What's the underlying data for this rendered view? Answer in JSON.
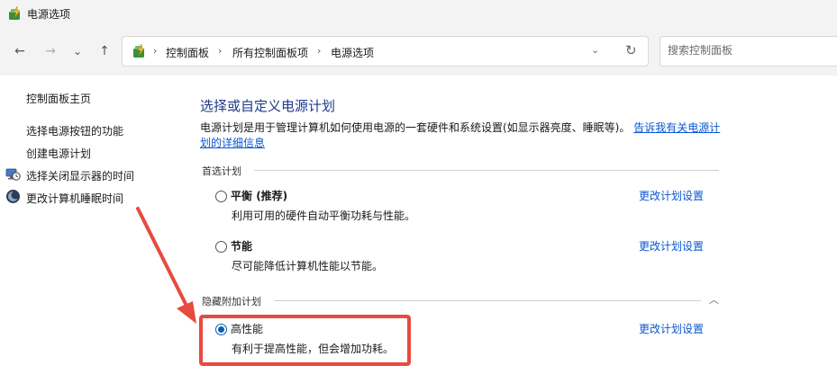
{
  "window": {
    "title": "电源选项"
  },
  "nav": {
    "back": "←",
    "forward": "→",
    "recent": "⌄",
    "up": "↑"
  },
  "address": {
    "crumbs": [
      "控制面板",
      "所有控制面板项",
      "电源选项"
    ],
    "separator": "›",
    "dropdown": "⌄",
    "refresh": "↻"
  },
  "search": {
    "placeholder": "搜索控制面板",
    "value": ""
  },
  "sidebar": {
    "home": "控制面板主页",
    "items": [
      "选择电源按钮的功能",
      "创建电源计划",
      "选择关闭显示器的时间",
      "更改计算机睡眠时间"
    ]
  },
  "main": {
    "title": "选择或自定义电源计划",
    "description": "电源计划是用于管理计算机如何使用电源的一套硬件和系统设置(如显示器亮度、睡眠等)。",
    "description_link": "告诉我有关电源计划的详细信息",
    "preferred_label": "首选计划",
    "hidden_label": "隐藏附加计划",
    "change_link": "更改计划设置",
    "plans": [
      {
        "name": "平衡",
        "suffix": " (推荐)",
        "desc": "利用可用的硬件自动平衡功耗与性能。",
        "selected": false
      },
      {
        "name": "节能",
        "suffix": "",
        "desc": "尽可能降低计算机性能以节能。",
        "selected": false
      },
      {
        "name": "高性能",
        "suffix": "",
        "desc": "有利于提高性能，但会增加功耗。",
        "selected": true
      }
    ]
  },
  "annotation": {
    "color": "#e84a3f"
  }
}
